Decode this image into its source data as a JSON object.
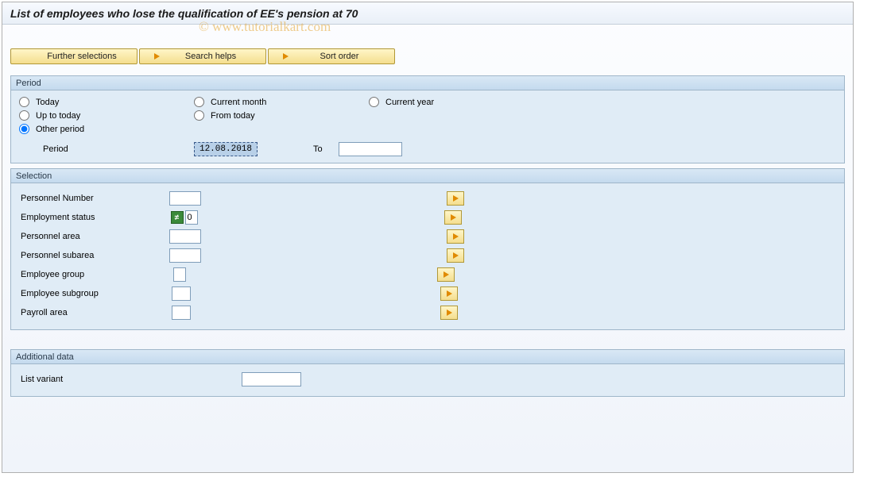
{
  "title": "List of employees who lose the qualification of EE's pension at 70",
  "watermark": "© www.tutorialkart.com",
  "toolbar": {
    "further_selections": "Further selections",
    "search_helps": "Search helps",
    "sort_order": "Sort order"
  },
  "period": {
    "header": "Period",
    "today": "Today",
    "current_month": "Current month",
    "current_year": "Current year",
    "up_to_today": "Up to today",
    "from_today": "From today",
    "other_period": "Other period",
    "selected": "other_period",
    "period_label": "Period",
    "period_from": "12.08.2018",
    "to_label": "To",
    "period_to": ""
  },
  "selection": {
    "header": "Selection",
    "fields": [
      {
        "label": "Personnel Number",
        "value": "",
        "width": "w40",
        "sel": true
      },
      {
        "label": "Employment status",
        "value": "0",
        "width": "w20",
        "ne": true,
        "sel": true
      },
      {
        "label": "Personnel area",
        "value": "",
        "width": "w40",
        "sel": true
      },
      {
        "label": "Personnel subarea",
        "value": "",
        "width": "w40",
        "sel": true
      },
      {
        "label": "Employee group",
        "value": "",
        "width": "w20",
        "sel": true
      },
      {
        "label": "Employee subgroup",
        "value": "",
        "width": "w24",
        "sel": true
      },
      {
        "label": "Payroll area",
        "value": "",
        "width": "w24",
        "sel": true
      }
    ]
  },
  "additional": {
    "header": "Additional data",
    "list_variant_label": "List variant",
    "list_variant_value": ""
  }
}
